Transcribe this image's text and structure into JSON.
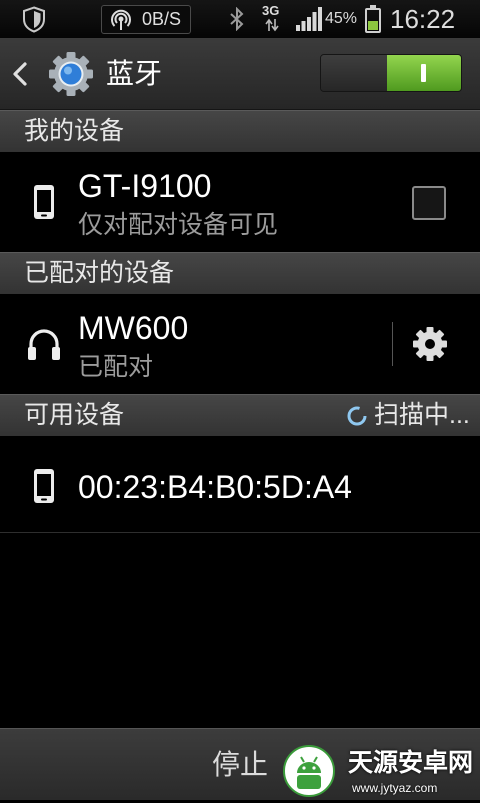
{
  "status_bar": {
    "net_speed": "0B/S",
    "network_type": "3G",
    "battery_text": "45%",
    "battery_level": 0.45,
    "signal_level": 5,
    "signal_max": 5,
    "time": "16:22"
  },
  "action_bar": {
    "title": "蓝牙",
    "bluetooth_enabled": true
  },
  "my_device": {
    "header": "我的设备",
    "name": "GT-I9100",
    "visibility": "仅对配对设备可见",
    "visible_checked": false
  },
  "paired_devices": {
    "header": "已配对的设备",
    "items": [
      {
        "name": "MW600",
        "status": "已配对"
      }
    ]
  },
  "available_devices": {
    "header": "可用设备",
    "scan_status": "扫描中...",
    "items": [
      {
        "name": "00:23:B4:B0:5D:A4"
      }
    ]
  },
  "bottom_bar": {
    "stop_label": "停止"
  },
  "watermark": {
    "name": "天源安卓网",
    "url": "www.jytyaz.com"
  },
  "icons": {
    "status_bar": [
      "shield-icon",
      "hotspot-icon",
      "bluetooth-icon",
      "data-arrows-icon",
      "signal-icon",
      "battery-icon"
    ],
    "back": "chevron-left-icon",
    "app": "bluetooth-settings-gear-icon",
    "my_device": "phone-icon",
    "paired_device": "headphones-icon",
    "paired_settings": "gear-icon",
    "available_device": "phone-icon",
    "scan": "spinner-icon"
  },
  "colors": {
    "toggle_on": "#5fa82b",
    "battery_fill": "#8cc63f",
    "spinner": "#8fc8f0",
    "app_icon_center": "#2f7ed8"
  }
}
